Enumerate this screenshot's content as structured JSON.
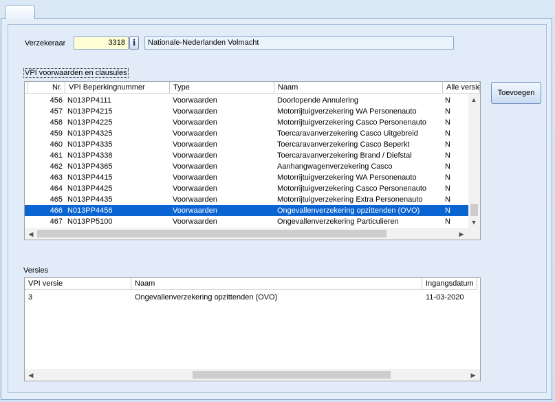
{
  "form": {
    "verzekeraar_label": "Verzekeraar",
    "verzekeraar_code": "3318",
    "info_label": "i",
    "verzekeraar_name": "Nationale-Nederlanden Volmacht"
  },
  "vpi_section": {
    "title": "VPI voorwaarden en clausules",
    "add_button": "Toevoegen",
    "columns": [
      "Nr.",
      "VPI Beperkingnummer",
      "Type",
      "Naam",
      "Alle versie"
    ],
    "rows": [
      {
        "nr": "456",
        "code": "N013PP4111",
        "type": "Voorwaarden",
        "naam": "Doorlopende Annulering",
        "alle": "N"
      },
      {
        "nr": "457",
        "code": "N013PP4215",
        "type": "Voorwaarden",
        "naam": "Motorrijtuigverzekering WA Personenauto",
        "alle": "N"
      },
      {
        "nr": "458",
        "code": "N013PP4225",
        "type": "Voorwaarden",
        "naam": "Motorrijtuigverzekering Casco Personenauto",
        "alle": "N"
      },
      {
        "nr": "459",
        "code": "N013PP4325",
        "type": "Voorwaarden",
        "naam": "Toercaravanverzekering Casco Uitgebreid",
        "alle": "N"
      },
      {
        "nr": "460",
        "code": "N013PP4335",
        "type": "Voorwaarden",
        "naam": "Toercaravanverzekering Casco Beperkt",
        "alle": "N"
      },
      {
        "nr": "461",
        "code": "N013PP4338",
        "type": "Voorwaarden",
        "naam": "Toercaravanverzekering Brand /  Diefstal",
        "alle": "N"
      },
      {
        "nr": "462",
        "code": "N013PP4365",
        "type": "Voorwaarden",
        "naam": "Aanhangwagenverzekering Casco",
        "alle": "N"
      },
      {
        "nr": "463",
        "code": "N013PP4415",
        "type": "Voorwaarden",
        "naam": "Motorrijtuigverzekering WA Personenauto",
        "alle": "N"
      },
      {
        "nr": "464",
        "code": "N013PP4425",
        "type": "Voorwaarden",
        "naam": "Motorrijtuigverzekering Casco Personenauto",
        "alle": "N"
      },
      {
        "nr": "465",
        "code": "N013PP4435",
        "type": "Voorwaarden",
        "naam": "Motorrijtuigverzekering Extra Personenauto",
        "alle": "N"
      },
      {
        "nr": "466",
        "code": "N013PP4456",
        "type": "Voorwaarden",
        "naam": "Ongevallenverzekering opzittenden (OVO)",
        "alle": "N"
      },
      {
        "nr": "467",
        "code": "N013PP5100",
        "type": "Voorwaarden",
        "naam": "Ongevallenverzekering Particulieren",
        "alle": "N"
      }
    ],
    "selected_row": 10
  },
  "versies_section": {
    "title": "Versies",
    "columns": [
      "VPI versie",
      "Naam",
      "Ingangsdatum"
    ],
    "rows": [
      {
        "versie": "3",
        "naam": "Ongevallenverzekering opzittenden (OVO)",
        "datum": "11-03-2020"
      }
    ]
  },
  "colors": {
    "selection": "#0a64d2",
    "code_field_bg": "#ffffd6",
    "name_field_bg": "#ebf3fc"
  }
}
